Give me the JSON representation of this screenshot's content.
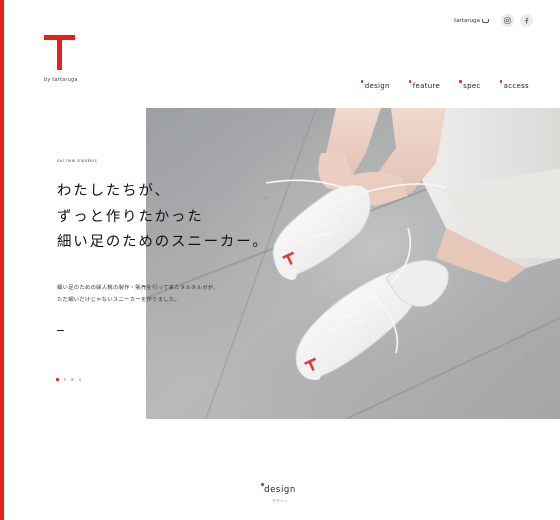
{
  "brand": {
    "logo_letter": "T",
    "logo_sub": "by tartaruga",
    "accent_color": "#e8201c"
  },
  "top_bar": {
    "brand_link": "tartaruga",
    "brand_icon": "cup-icon",
    "social": [
      "instagram-icon",
      "facebook-icon"
    ]
  },
  "nav": {
    "items": [
      {
        "label": "design"
      },
      {
        "label": "feature"
      },
      {
        "label": "spec"
      },
      {
        "label": "access"
      }
    ]
  },
  "hero": {
    "eyebrow": "our new sneakers",
    "headline": [
      "わたしたちが、",
      "ずっと作りたかった",
      "細い足のためのスニーカー。"
    ],
    "body": [
      "細い足のための婦人靴の製作・販売を行って来たタルタルガが、",
      "ただ細いだけじゃないスニーカーを作りました。"
    ],
    "slides": {
      "count": 4,
      "active": 1
    },
    "image_icon": "sneakers-photo"
  },
  "section": {
    "title_en": "design",
    "title_ja": "デザイン"
  }
}
